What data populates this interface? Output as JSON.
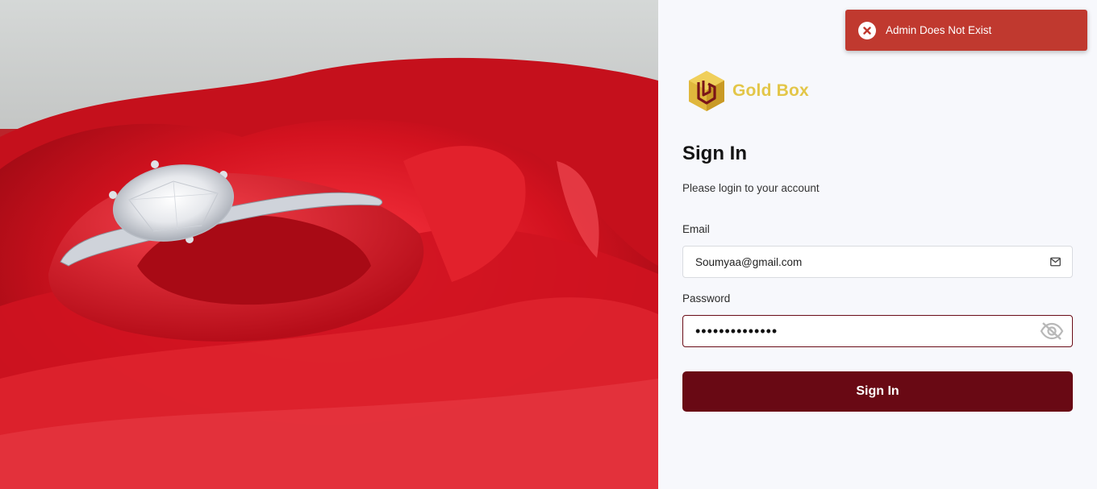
{
  "brand": {
    "name": "Gold Box",
    "accent_color": "#e3c648",
    "logo_icon": "gold-box-hexagon-icon"
  },
  "hero": {
    "image_icon": "diamond-ring-on-red-rose-photo"
  },
  "toast": {
    "message": "Admin Does Not Exist",
    "icon": "error-x-icon",
    "background_color": "#c0392f"
  },
  "form": {
    "title": "Sign In",
    "subtitle": "Please login to your account",
    "email": {
      "label": "Email",
      "value": "Soumyaa@gmail.com",
      "icon": "envelope-icon"
    },
    "password": {
      "label": "Password",
      "value": "••••••••••••••",
      "icon": "eye-slash-icon"
    },
    "submit_label": "Sign In",
    "submit_color": "#690914"
  }
}
